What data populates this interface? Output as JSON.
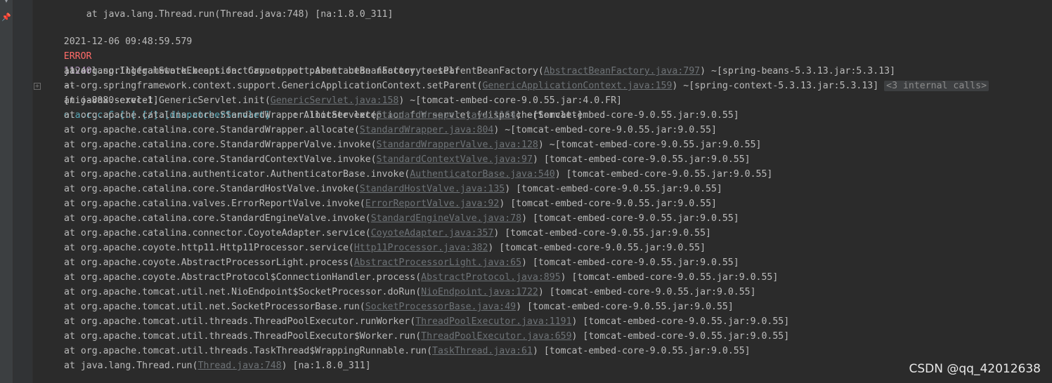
{
  "header": {
    "partial_line": "at java.lang.Thread.run(Thread.java:748) [na:1.8.0_311]"
  },
  "log": {
    "timestamp": "2021-12-06 09:48:59.579",
    "level": "ERROR",
    "pid": "11240",
    "separator": "---",
    "thread": "[nio-8080-exec-1]",
    "logger": "o.a.c.c.C.[.[.[/].[dispatcherServlet]",
    "message": ": Allocate exception for servlet [dispatcherServlet]"
  },
  "exception": "java.lang.IllegalStateException: Cannot set parent bean factory to self",
  "frames": [
    {
      "pre": "at org.springframework.beans.factory.support.AbstractBeanFactory.setParentBeanFactory(",
      "link": "AbstractBeanFactory.java:797",
      "post": ") ~[spring-beans-5.3.13.jar:5.3.13]"
    },
    {
      "pre": "at org.springframework.context.support.GenericApplicationContext.setParent(",
      "link": "GenericApplicationContext.java:159",
      "post": ") ~[spring-context-5.3.13.jar:5.3.13]",
      "internal": "<3 internal calls>"
    },
    {
      "pre": "at javax.servlet.GenericServlet.init(",
      "link": "GenericServlet.java:158",
      "post": ") ~[tomcat-embed-core-9.0.55.jar:4.0.FR]"
    },
    {
      "pre": "at org.apache.catalina.core.StandardWrapper.initServlet(",
      "link": "StandardWrapper.java:1164",
      "post": ") ~[tomcat-embed-core-9.0.55.jar:9.0.55]"
    },
    {
      "pre": "at org.apache.catalina.core.StandardWrapper.allocate(",
      "link": "StandardWrapper.java:804",
      "post": ") ~[tomcat-embed-core-9.0.55.jar:9.0.55]"
    },
    {
      "pre": "at org.apache.catalina.core.StandardWrapperValve.invoke(",
      "link": "StandardWrapperValve.java:128",
      "post": ") ~[tomcat-embed-core-9.0.55.jar:9.0.55]"
    },
    {
      "pre": "at org.apache.catalina.core.StandardContextValve.invoke(",
      "link": "StandardContextValve.java:97",
      "post": ") [tomcat-embed-core-9.0.55.jar:9.0.55]"
    },
    {
      "pre": "at org.apache.catalina.authenticator.AuthenticatorBase.invoke(",
      "link": "AuthenticatorBase.java:540",
      "post": ") [tomcat-embed-core-9.0.55.jar:9.0.55]"
    },
    {
      "pre": "at org.apache.catalina.core.StandardHostValve.invoke(",
      "link": "StandardHostValve.java:135",
      "post": ") [tomcat-embed-core-9.0.55.jar:9.0.55]"
    },
    {
      "pre": "at org.apache.catalina.valves.ErrorReportValve.invoke(",
      "link": "ErrorReportValve.java:92",
      "post": ") [tomcat-embed-core-9.0.55.jar:9.0.55]"
    },
    {
      "pre": "at org.apache.catalina.core.StandardEngineValve.invoke(",
      "link": "StandardEngineValve.java:78",
      "post": ") [tomcat-embed-core-9.0.55.jar:9.0.55]"
    },
    {
      "pre": "at org.apache.catalina.connector.CoyoteAdapter.service(",
      "link": "CoyoteAdapter.java:357",
      "post": ") [tomcat-embed-core-9.0.55.jar:9.0.55]"
    },
    {
      "pre": "at org.apache.coyote.http11.Http11Processor.service(",
      "link": "Http11Processor.java:382",
      "post": ") [tomcat-embed-core-9.0.55.jar:9.0.55]"
    },
    {
      "pre": "at org.apache.coyote.AbstractProcessorLight.process(",
      "link": "AbstractProcessorLight.java:65",
      "post": ") [tomcat-embed-core-9.0.55.jar:9.0.55]"
    },
    {
      "pre": "at org.apache.coyote.AbstractProtocol$ConnectionHandler.process(",
      "link": "AbstractProtocol.java:895",
      "post": ") [tomcat-embed-core-9.0.55.jar:9.0.55]"
    },
    {
      "pre": "at org.apache.tomcat.util.net.NioEndpoint$SocketProcessor.doRun(",
      "link": "NioEndpoint.java:1722",
      "post": ") [tomcat-embed-core-9.0.55.jar:9.0.55]"
    },
    {
      "pre": "at org.apache.tomcat.util.net.SocketProcessorBase.run(",
      "link": "SocketProcessorBase.java:49",
      "post": ") [tomcat-embed-core-9.0.55.jar:9.0.55]"
    },
    {
      "pre": "at org.apache.tomcat.util.threads.ThreadPoolExecutor.runWorker(",
      "link": "ThreadPoolExecutor.java:1191",
      "post": ") [tomcat-embed-core-9.0.55.jar:9.0.55]"
    },
    {
      "pre": "at org.apache.tomcat.util.threads.ThreadPoolExecutor$Worker.run(",
      "link": "ThreadPoolExecutor.java:659",
      "post": ") [tomcat-embed-core-9.0.55.jar:9.0.55]"
    },
    {
      "pre": "at org.apache.tomcat.util.threads.TaskThread$WrappingRunnable.run(",
      "link": "TaskThread.java:61",
      "post": ") [tomcat-embed-core-9.0.55.jar:9.0.55]"
    },
    {
      "pre": "at java.lang.Thread.run(",
      "link": "Thread.java:748",
      "post": ") [na:1.8.0_311]"
    }
  ],
  "icons": {
    "sidebar": [
      "chevron-down-icon",
      "pin-icon"
    ],
    "fold": "expand-icon"
  },
  "colors": {
    "background": "#2b2b2b",
    "error": "#ff6b68",
    "pid": "#b294bb",
    "logger": "#56a8b8",
    "link": "#6e7377"
  },
  "watermark": "CSDN @qq_42012638"
}
